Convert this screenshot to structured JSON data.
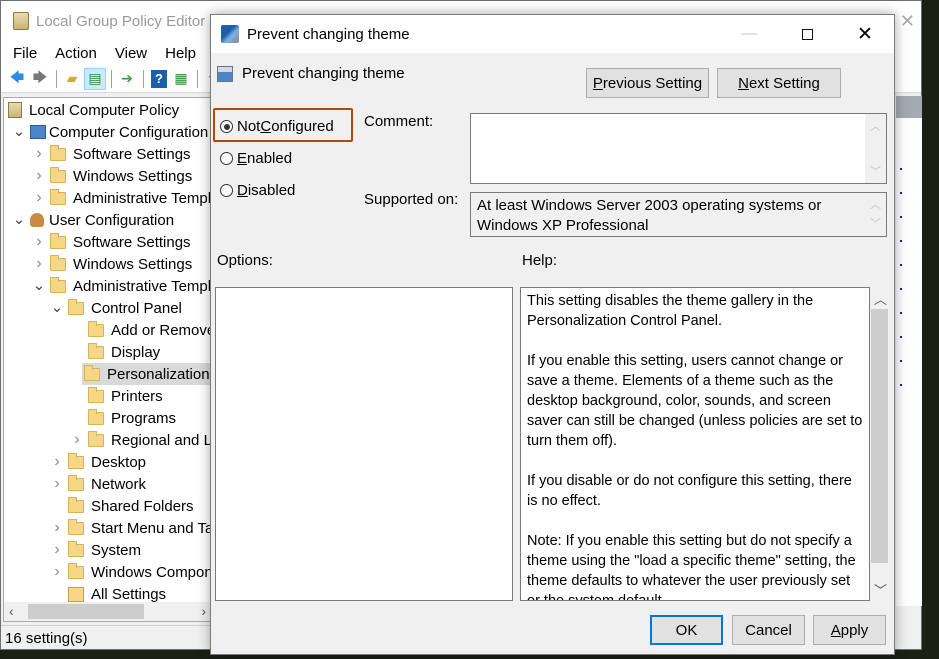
{
  "main_window": {
    "title": "Local Group Policy Editor",
    "menu": [
      "File",
      "Action",
      "View",
      "Help"
    ],
    "toolbar_icons": [
      "back-arrow-icon",
      "forward-arrow-icon",
      "up-folder-icon",
      "show-hide-tree-icon",
      "export-list-icon",
      "help-icon",
      "show-action-pane-icon",
      "filter-icon"
    ],
    "tree": [
      {
        "label": "Local Computer Policy",
        "level": 0,
        "icon": "policy-icon",
        "expander": "none"
      },
      {
        "label": "Computer Configuration",
        "level": 1,
        "icon": "computer-icon",
        "expander": "expanded"
      },
      {
        "label": "Software Settings",
        "level": 2,
        "icon": "folder-icon",
        "expander": "collapsed"
      },
      {
        "label": "Windows Settings",
        "level": 2,
        "icon": "folder-icon",
        "expander": "collapsed"
      },
      {
        "label": "Administrative Templa",
        "level": 2,
        "icon": "folder-icon",
        "expander": "collapsed"
      },
      {
        "label": "User Configuration",
        "level": 1,
        "icon": "user-icon",
        "expander": "expanded"
      },
      {
        "label": "Software Settings",
        "level": 2,
        "icon": "folder-icon",
        "expander": "collapsed"
      },
      {
        "label": "Windows Settings",
        "level": 2,
        "icon": "folder-icon",
        "expander": "collapsed"
      },
      {
        "label": "Administrative Templa",
        "level": 2,
        "icon": "folder-icon",
        "expander": "expanded"
      },
      {
        "label": "Control Panel",
        "level": 3,
        "icon": "folder-icon",
        "expander": "expanded"
      },
      {
        "label": "Add or Remove",
        "level": 4,
        "icon": "folder-icon",
        "expander": "none"
      },
      {
        "label": "Display",
        "level": 4,
        "icon": "folder-icon",
        "expander": "none"
      },
      {
        "label": "Personalization",
        "level": 4,
        "icon": "folder-icon",
        "expander": "none",
        "selected": true
      },
      {
        "label": "Printers",
        "level": 4,
        "icon": "folder-icon",
        "expander": "none"
      },
      {
        "label": "Programs",
        "level": 4,
        "icon": "folder-icon",
        "expander": "none"
      },
      {
        "label": "Regional and La",
        "level": 4,
        "icon": "folder-icon",
        "expander": "collapsed"
      },
      {
        "label": "Desktop",
        "level": 3,
        "icon": "folder-icon",
        "expander": "collapsed"
      },
      {
        "label": "Network",
        "level": 3,
        "icon": "folder-icon",
        "expander": "collapsed"
      },
      {
        "label": "Shared Folders",
        "level": 3,
        "icon": "folder-icon",
        "expander": "none"
      },
      {
        "label": "Start Menu and Tas",
        "level": 3,
        "icon": "folder-icon",
        "expander": "collapsed"
      },
      {
        "label": "System",
        "level": 3,
        "icon": "folder-icon",
        "expander": "collapsed"
      },
      {
        "label": "Windows Compone",
        "level": 3,
        "icon": "folder-icon",
        "expander": "collapsed"
      },
      {
        "label": "All Settings",
        "level": 3,
        "icon": "all-settings-icon",
        "expander": "none"
      }
    ],
    "status": "16 setting(s)"
  },
  "dialog": {
    "title": "Prevent changing theme",
    "setting_name": "Prevent changing theme",
    "prev_button": {
      "mnemonic": "P",
      "rest": "revious Setting"
    },
    "next_button": {
      "mnemonic": "N",
      "rest": "ext Setting"
    },
    "radios": [
      {
        "pre": "Not ",
        "mnemonic": "C",
        "rest": "onfigured",
        "checked": true
      },
      {
        "pre": "",
        "mnemonic": "E",
        "rest": "nabled",
        "checked": false
      },
      {
        "pre": "",
        "mnemonic": "D",
        "rest": "isabled",
        "checked": false
      }
    ],
    "comment_label": "Comment:",
    "comment_value": "",
    "supported_label": "Supported on:",
    "supported_value": "At least Windows Server 2003 operating systems or Windows XP Professional",
    "options_label": "Options:",
    "help_label": "Help:",
    "help_paragraphs": [
      "This setting disables the theme gallery in the Personalization Control Panel.",
      "If you enable this setting, users cannot change or save a theme.  Elements of a theme such as the desktop background, color, sounds, and screen saver can still be changed (unless policies are set to turn them off).",
      "If you disable or do not configure this setting, there is no effect.",
      "Note: If you enable this setting but do not specify a theme using the \"load a specific theme\" setting, the theme defaults to whatever the user previously set or the system default."
    ],
    "ok_label": "OK",
    "cancel_label": "Cancel",
    "apply_button": {
      "mnemonic": "A",
      "rest": "pply"
    },
    "highlight_color": "#b04a0d",
    "default_button_color": "#0078d7"
  }
}
